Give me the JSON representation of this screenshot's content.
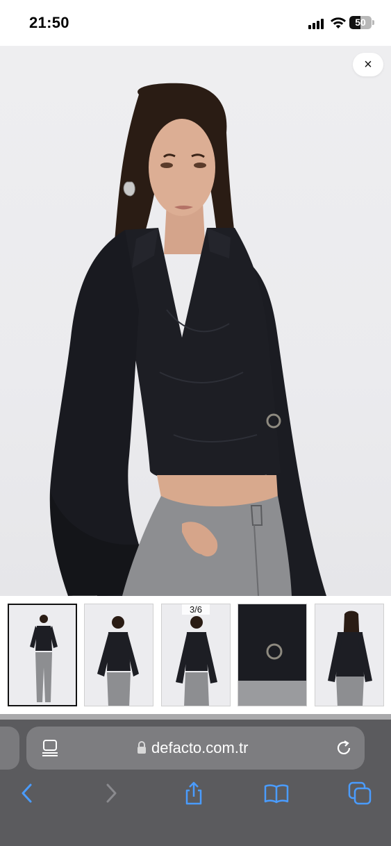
{
  "status_bar": {
    "time": "21:50",
    "battery_level": "50"
  },
  "product_viewer": {
    "close_icon": "close-icon",
    "close_label": "×",
    "image_counter": "3/6",
    "current_index": 3,
    "total_images": 6
  },
  "thumbnails": [
    {
      "name": "full-length-front",
      "active": true
    },
    {
      "name": "three-quarter-front",
      "active": false
    },
    {
      "name": "front-crop",
      "active": false
    },
    {
      "name": "buckle-detail",
      "active": false
    },
    {
      "name": "back-view",
      "active": false
    }
  ],
  "browser": {
    "url": "defacto.com.tr",
    "icons": [
      "reader-icon",
      "lock-icon",
      "reload-icon",
      "back-icon",
      "forward-icon",
      "share-icon",
      "bookmarks-icon",
      "tabs-icon"
    ],
    "accent_color": "#4a9cff"
  }
}
